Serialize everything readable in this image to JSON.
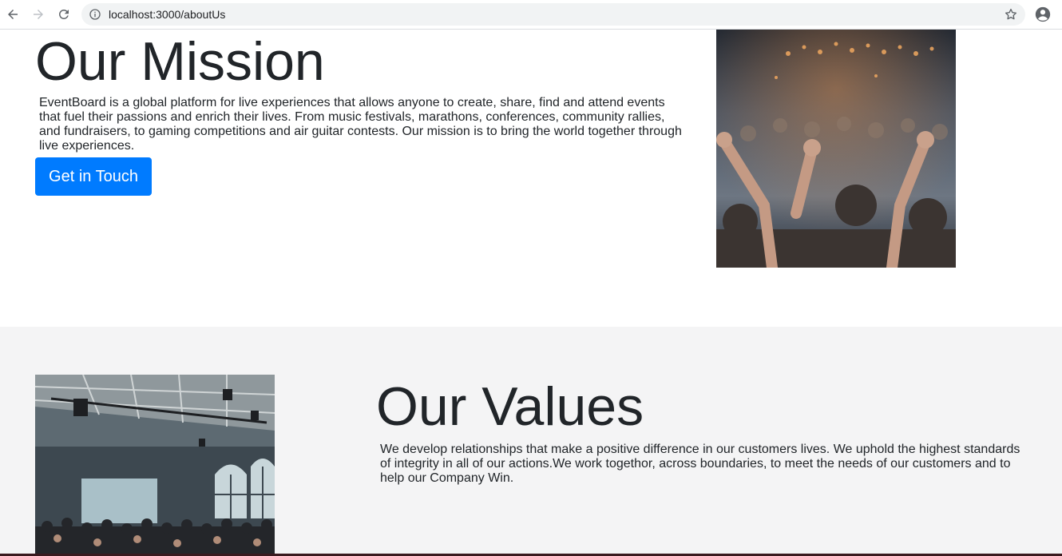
{
  "browser": {
    "url": "localhost:3000/aboutUs",
    "back_icon": "arrow-left-icon",
    "forward_icon": "arrow-right-icon",
    "reload_icon": "reload-icon",
    "info_icon": "info-icon",
    "bookmark_icon": "star-icon",
    "account_icon": "account-icon"
  },
  "mission": {
    "title": "Our Mission",
    "text": "EventBoard is a global platform for live experiences that allows anyone to create, share, find and attend events that fuel their passions and enrich their lives. From music festivals, marathons, conferences, community rallies, and fundraisers, to gaming competitions and air guitar contests. Our mission is to bring the world together through live experiences.",
    "button_label": "Get in Touch",
    "accent_color": "#007bff"
  },
  "values": {
    "title": "Our Values",
    "text": "We develop relationships that make a positive difference in our customers lives. We uphold the highest standards of integrity in all of our actions.We work togethor, across boundaries, to meet the needs of our customers and to help our Company Win."
  }
}
